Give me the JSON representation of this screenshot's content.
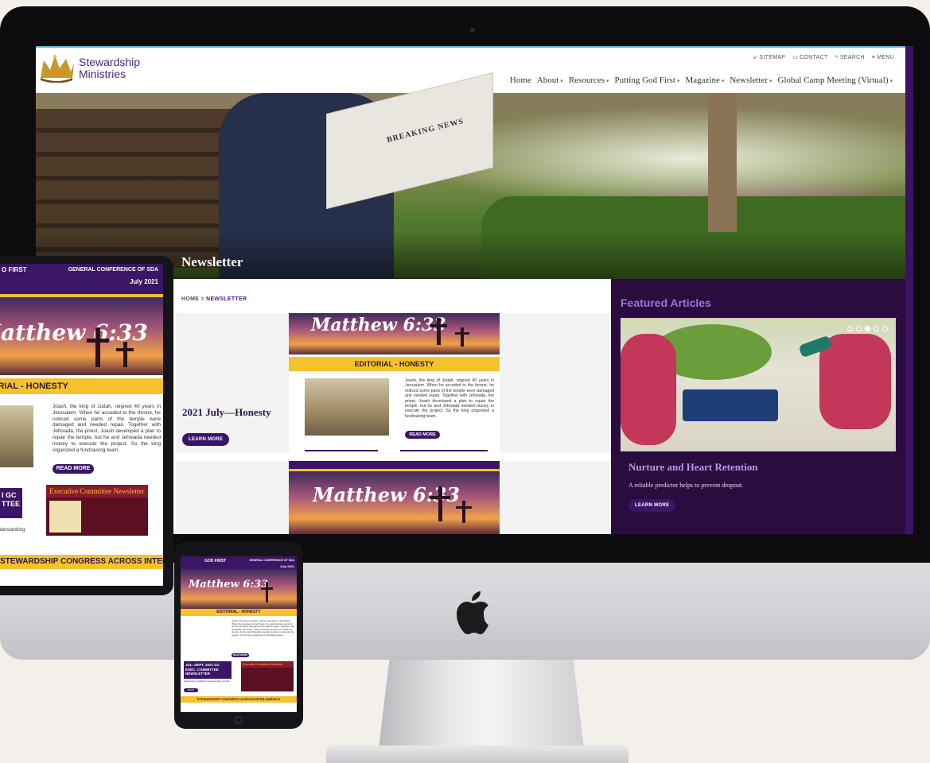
{
  "site": {
    "logo_line1": "Stewardship",
    "logo_line2": "Ministries",
    "utility": [
      "SITEMAP",
      "CONTACT",
      "SEARCH",
      "MENU"
    ],
    "nav": [
      {
        "label": "Home",
        "dropdown": false
      },
      {
        "label": "About",
        "dropdown": true
      },
      {
        "label": "Resources",
        "dropdown": true
      },
      {
        "label": "Putting God First",
        "dropdown": true
      },
      {
        "label": "Magazine",
        "dropdown": true
      },
      {
        "label": "Newsletter",
        "dropdown": true
      },
      {
        "label": "Global Camp Meeting (Virtual)",
        "dropdown": true
      }
    ],
    "hero_paper": "BREAKING NEWS",
    "hero_title": "Newsletter",
    "breadcrumb_home": "HOME",
    "breadcrumb_sep": ">",
    "breadcrumb_current": "NEWSLETTER",
    "card_title": "2021 July—Honesty",
    "card_button": "LEARN MORE",
    "featured_heading": "Featured Articles",
    "featured_title": "Nurture and Heart Retention",
    "featured_desc": "A reliable predictor helps to prevent dropout.",
    "featured_button": "LEARN MORE"
  },
  "newsletter": {
    "script_title": "Matthew 6:33",
    "editorial": "EDITORIAL - HONESTY",
    "body": "Joash, the king of Judah, reigned 40 years in Jerusalem. When he acceded to the throne, he noticed some parts of the temple were damaged and needed repair. Together with Jehoiada, the priest, Joash developed a plan to repair the temple, but he and Jehoiada needed money to execute the project. So the king organized a fundraising team.",
    "read_more": "READ MORE",
    "header_left": "GOD FIRST",
    "header_right": "GENERAL CONFERENCE OF SDA",
    "date": "July 2021",
    "exec_box": "JUL.-SEPT. 2021 GC EXEC. COMMITTEE NEWSLETTER",
    "exec_title": "Executive Committee Newsletter",
    "exec_desc": "Addressing a biblical understanding of tithe",
    "congress": "STEWARDSHIP CONGRESS ACROSS INTER-AMERICA",
    "tablet_head": "O FIRST",
    "tablet_exec_box": "I GC\nTTEE",
    "tablet_understanding": "derstanding"
  },
  "colors": {
    "brand_purple": "#3b1566",
    "featured_bg": "#2a0d3e",
    "gold": "#f5c22b"
  }
}
